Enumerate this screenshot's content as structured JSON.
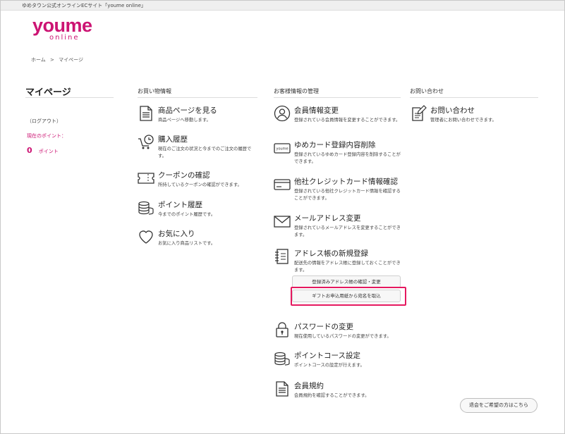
{
  "site_header": {
    "text": "ゆめタウン公式オンラインECサイト「youme online」"
  },
  "logo": {
    "main": "youme",
    "sub": "online"
  },
  "breadcrumb": {
    "home": "ホーム",
    "separator": ">",
    "current": "マイページ"
  },
  "sidebar": {
    "title": "マイページ",
    "logout": "（ログアウト）",
    "points_label": "現在のポイント：",
    "points_value": "0",
    "points_unit": "ポイント"
  },
  "shopping": {
    "heading": "お買い物情報",
    "items": [
      {
        "title": "商品ページを見る",
        "desc": "商品ページへ移動します。",
        "icon": "document-icon"
      },
      {
        "title": "購入履歴",
        "desc": "現在のご注文の状況と今までのご注文の履歴です。",
        "icon": "cart-clock-icon"
      },
      {
        "title": "クーポンの確認",
        "desc": "所持しているクーポンの確認ができます。",
        "icon": "coupon-icon"
      },
      {
        "title": "ポイント履歴",
        "desc": "今までのポイント履歴です。",
        "icon": "coins-icon"
      },
      {
        "title": "お気に入り",
        "desc": "お気に入り商品リストです。",
        "icon": "heart-icon"
      }
    ]
  },
  "customer": {
    "heading": "お客様情報の管理",
    "items": [
      {
        "title": "会員情報変更",
        "desc": "登録されている会員情報を変更することができます。",
        "icon": "user-icon"
      },
      {
        "title": "ゆめカード登録内容削除",
        "desc": "登録されているゆめカード登録内容を削除することができます。",
        "icon": "youme-card-icon"
      },
      {
        "title": "他社クレジットカード情報確認",
        "desc": "登録されている他社クレジットカード情報を確認することができます。",
        "icon": "credit-card-icon"
      },
      {
        "title": "メールアドレス変更",
        "desc": "登録されているメールアドレスを変更することができます。",
        "icon": "envelope-icon"
      },
      {
        "title": "アドレス帳の新規登録",
        "desc": "配送先の情報をアドレス帳に登録しておくことができます。",
        "icon": "address-book-icon"
      },
      {
        "title": "パスワードの変更",
        "desc": "現在使用しているパスワードの変更ができます。",
        "icon": "lock-icon"
      },
      {
        "title": "ポイントコース設定",
        "desc": "ポイントコースの設定が行えます。",
        "icon": "coins-icon"
      },
      {
        "title": "会員規約",
        "desc": "会員規約を確認することができます。",
        "icon": "document-icon"
      }
    ],
    "address_buttons": {
      "confirm": "登録済みアドレス帳の確認・変更",
      "gift": "ギフトお申込用紙から宛名を取込"
    }
  },
  "contact": {
    "heading": "お問い合わせ",
    "items": [
      {
        "title": "お問い合わせ",
        "desc": "管理者にお問い合わせできます。",
        "icon": "edit-document-icon"
      }
    ]
  },
  "withdraw": {
    "label": "退会をご希望の方はこちら"
  },
  "colors": {
    "brand": "#cc1473",
    "highlight": "#e5185f"
  }
}
